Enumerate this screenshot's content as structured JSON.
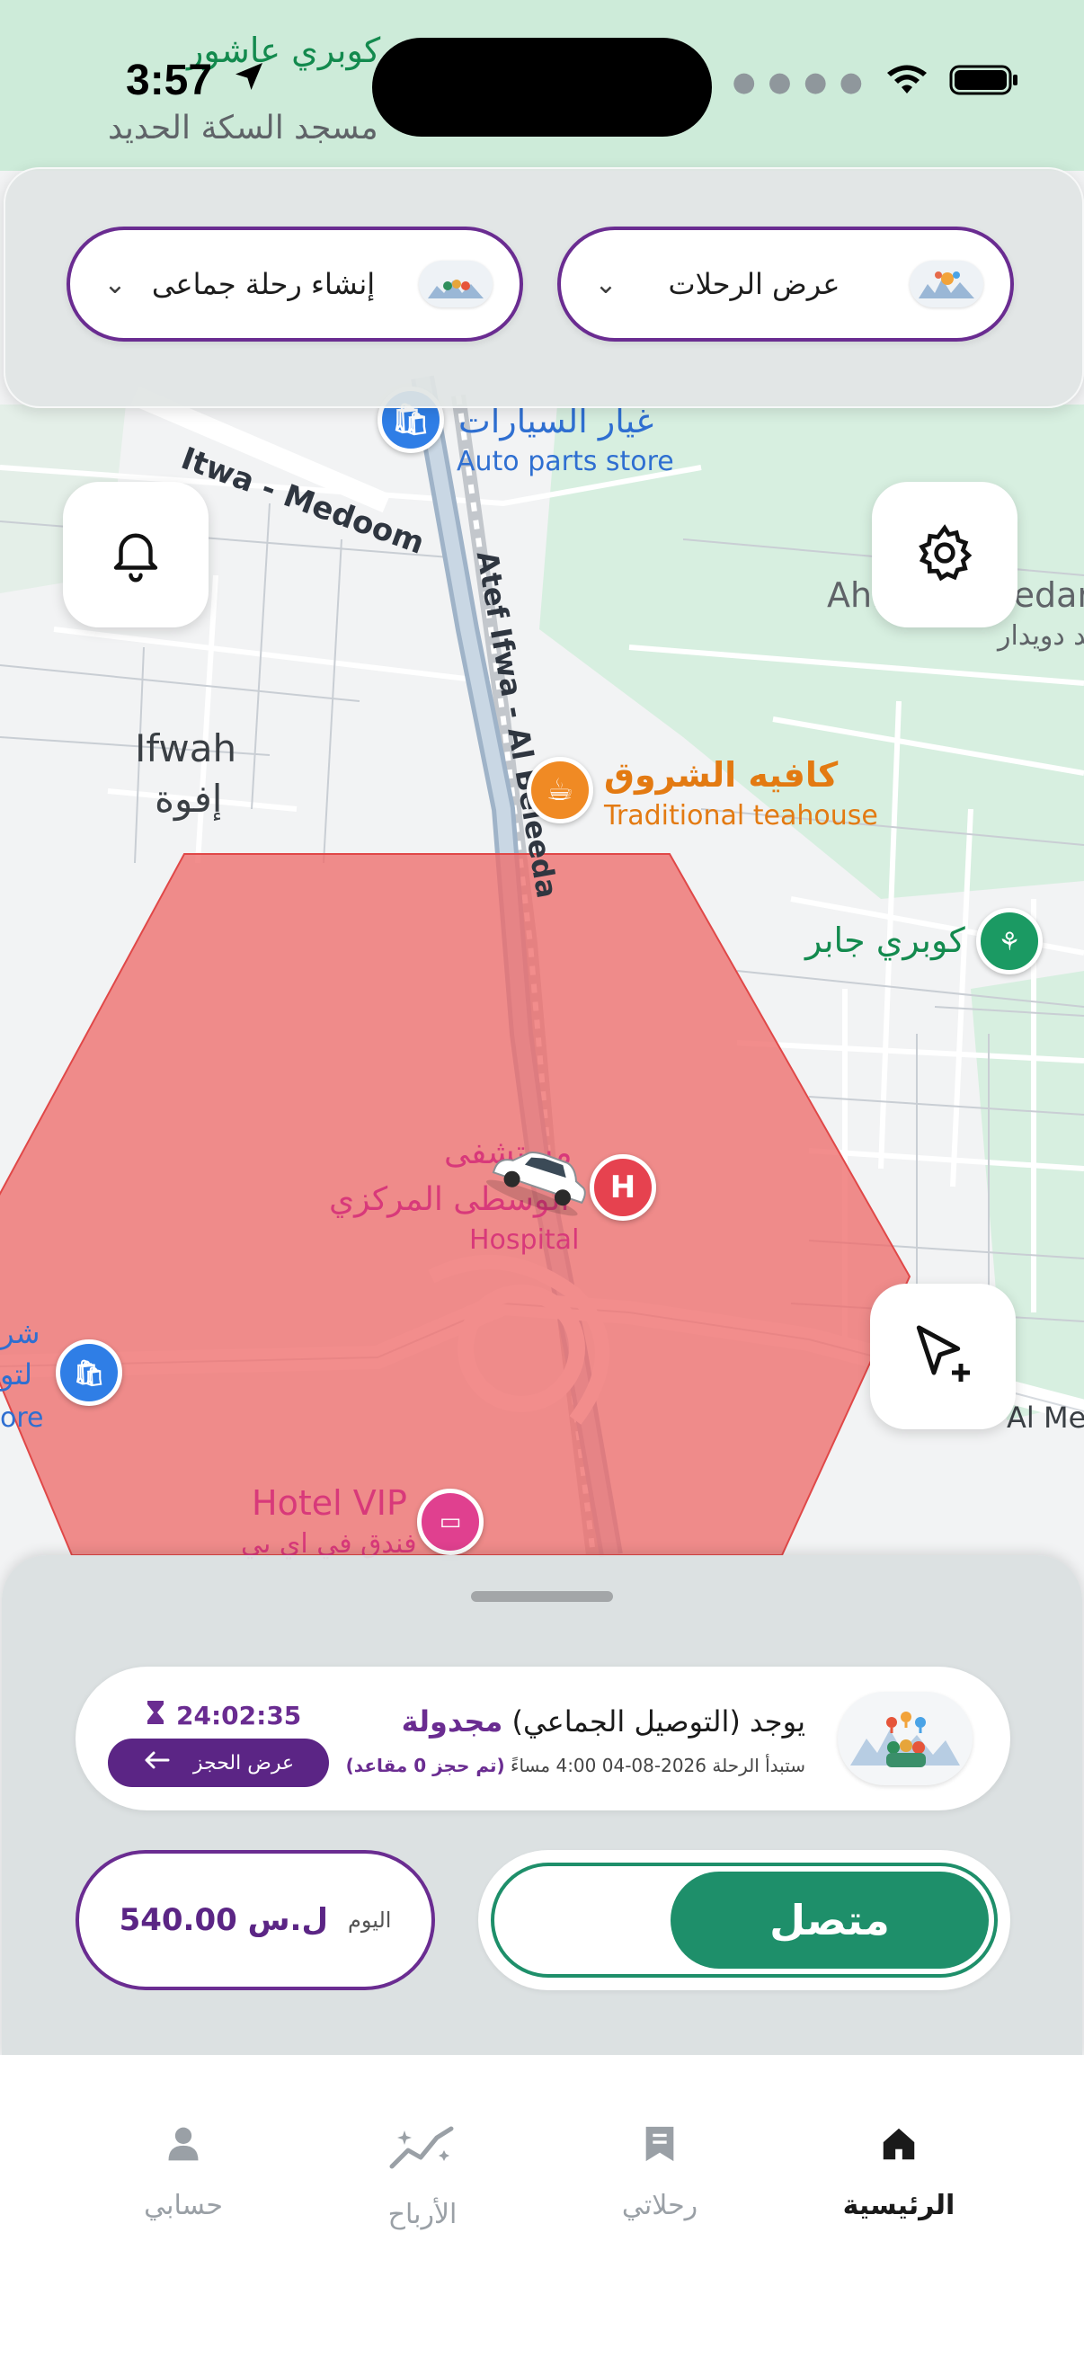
{
  "status_bar": {
    "time": "3:57"
  },
  "top_actions": {
    "create_group_trip": "إنشاء رحلة جماعى",
    "view_trips": "عرض الرحلات"
  },
  "map": {
    "labels": {
      "bridge_ashour": "كوبري عاشور",
      "iron_mosque": "مسجد السكة الحديد",
      "parts_ar": "غيار السيارات",
      "parts_en": "Auto parts store",
      "road_medoom": "Itwa - Medoom",
      "road_beleeda": "Atef Ifwa - Al Beleeda",
      "ahmed_en": "Ahmed Owedar",
      "ahmed_ar": "احمد دويدار",
      "ifwah_en": "Ifwah",
      "ifwah_ar": "إفوة",
      "cafe_ar": "كافيه الشروق",
      "cafe_en": "Traditional teahouse",
      "bridge_jaber": "كوبري جابر",
      "hospital_ar_1": "مستشفى",
      "hospital_ar_2": "الوسطى المركزي",
      "hospital_en": "Hospital",
      "store_ar_1": "شر",
      "store_ar_2": "لتو",
      "store_en": "ore",
      "hotel_en": "Hotel VIP",
      "hotel_ar": "فندق في اي بي",
      "menia": "Al Meni"
    },
    "zone_color": "#ee6d6b"
  },
  "trip_card": {
    "title_prefix": "يوجد (التوصيل الجماعي)",
    "title_accent": "مجدولة",
    "subtitle_prefix": "ستبدأ الرحلة 2026-08-04 4:00 مساءً",
    "subtitle_accent": "(تم حجز 0 مقاعد)",
    "countdown": "24:02:35",
    "view_booking": "عرض الحجز"
  },
  "earnings": {
    "label": "اليوم",
    "amount": "540.00 ل.س"
  },
  "online_toggle": {
    "label": "متصل",
    "state": "on"
  },
  "tabs": [
    {
      "label": "الرئيسية",
      "icon": "home-icon",
      "active": true
    },
    {
      "label": "رحلاتي",
      "icon": "bookmark-icon",
      "active": false
    },
    {
      "label": "الأرباح",
      "icon": "chart-icon",
      "active": false
    },
    {
      "label": "حسابي",
      "icon": "user-icon",
      "active": false
    }
  ],
  "colors": {
    "brand_purple": "#6a2c91",
    "online_green": "#1e8f6a"
  }
}
